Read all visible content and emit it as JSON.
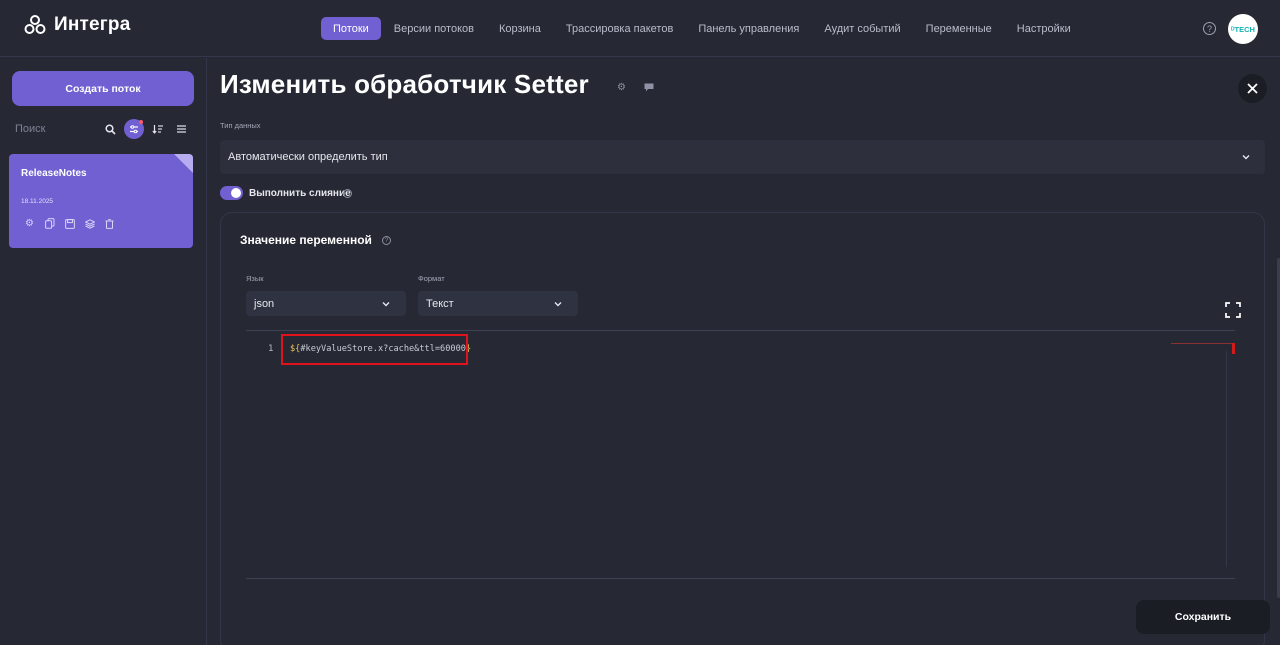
{
  "app": {
    "name": "Интегра"
  },
  "nav": {
    "items": [
      {
        "label": "Потоки",
        "active": true
      },
      {
        "label": "Версии потоков"
      },
      {
        "label": "Корзина"
      },
      {
        "label": "Трассировка пакетов"
      },
      {
        "label": "Панель управления"
      },
      {
        "label": "Аудит событий"
      },
      {
        "label": "Переменные"
      },
      {
        "label": "Настройки"
      }
    ],
    "avatar_text": "ᴰTECH"
  },
  "sidebar": {
    "create_label": "Создать поток",
    "search_placeholder": "Поиск",
    "flows": [
      {
        "title": "ReleaseNotes",
        "date": "18.11.2025"
      }
    ]
  },
  "main": {
    "title": "Изменить обработчик Setter",
    "data_type_label": "Тип данных",
    "data_type_value": "Автоматически определить тип",
    "merge_label": "Выполнить слияние",
    "merge_enabled": true,
    "var_panel_title": "Значение переменной",
    "language_label": "Язык",
    "language_value": "json",
    "format_label": "Формат",
    "format_value": "Текст",
    "editor": {
      "line_number": "1",
      "code_open": "${",
      "code_body": "#keyValueStore.x?cache&ttl=60000",
      "code_close": "}"
    },
    "save_label": "Сохранить"
  },
  "colors": {
    "accent": "#7060d2",
    "background": "#262833",
    "highlight_border": "#e0131c"
  }
}
